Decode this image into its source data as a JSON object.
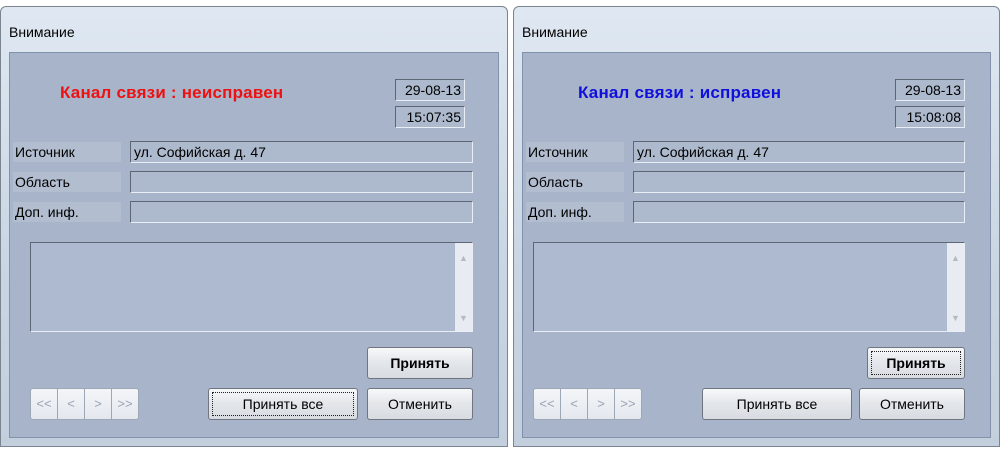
{
  "windows": [
    {
      "title": "Внимание",
      "status_text": "Канал связи : неисправен",
      "status_color": "#ee1111",
      "date": "29-08-13",
      "time": "15:07:35",
      "source_label": "Источник",
      "source_value": "ул. Софийская д. 47",
      "area_label": "Область",
      "area_value": "",
      "info_label": "Доп. инф.",
      "info_value": "",
      "accept_label": "Принять",
      "nav": [
        "<<",
        "<",
        ">",
        ">>"
      ],
      "accept_all_label": "Принять все",
      "cancel_label": "Отменить"
    },
    {
      "title": "Внимание",
      "status_text": "Канал связи : исправен",
      "status_color": "#1010dd",
      "date": "29-08-13",
      "time": "15:08:08",
      "source_label": "Источник",
      "source_value": "ул. Софийская д. 47",
      "area_label": "Область",
      "area_value": "",
      "info_label": "Доп. инф.",
      "info_value": "",
      "accept_label": "Принять",
      "nav": [
        "<<",
        "<",
        ">",
        ">>"
      ],
      "accept_all_label": "Принять все",
      "cancel_label": "Отменить"
    }
  ],
  "icons": {
    "scroll_up": "▲",
    "scroll_down": "▼"
  }
}
